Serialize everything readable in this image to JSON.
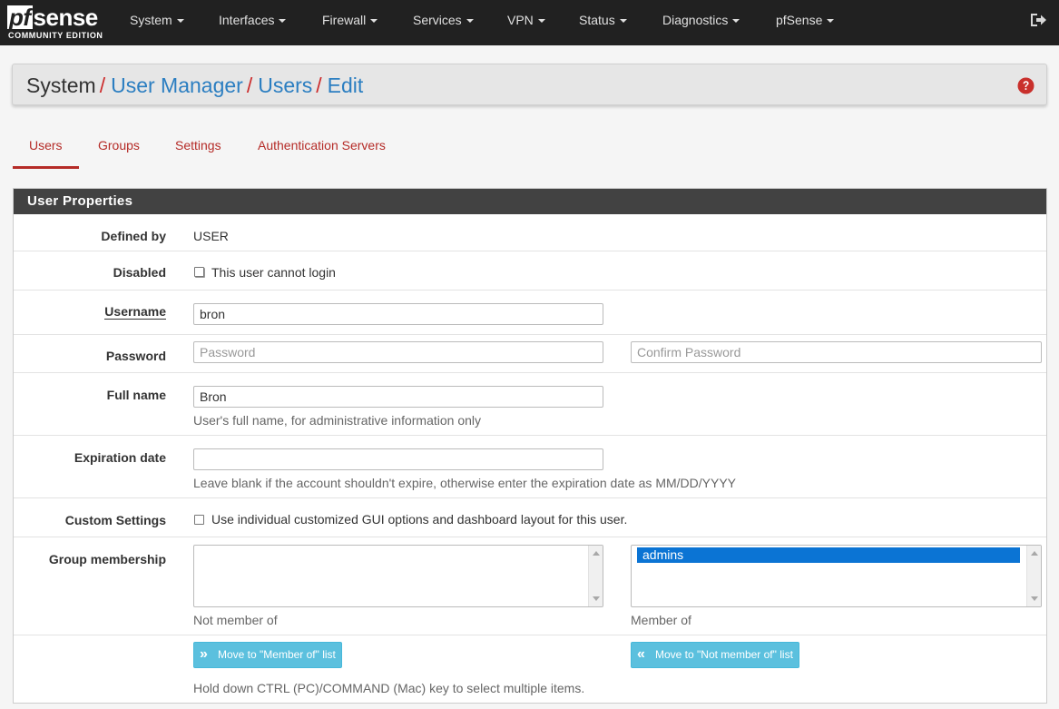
{
  "navbar": {
    "logo_main": "sense",
    "logo_pf": "pf",
    "logo_sub": "COMMUNITY EDITION",
    "items": [
      {
        "label": "System"
      },
      {
        "label": "Interfaces"
      },
      {
        "label": "Firewall"
      },
      {
        "label": "Services"
      },
      {
        "label": "VPN"
      },
      {
        "label": "Status"
      },
      {
        "label": "Diagnostics"
      },
      {
        "label": "pfSense"
      }
    ],
    "logout_icon": "sign-out-icon"
  },
  "breadcrumb": {
    "root": "System",
    "items": [
      "User Manager",
      "Users",
      "Edit"
    ],
    "separator": "/",
    "help_icon": "question-circle-icon"
  },
  "tabs": [
    {
      "label": "Users",
      "active": true
    },
    {
      "label": "Groups",
      "active": false
    },
    {
      "label": "Settings",
      "active": false
    },
    {
      "label": "Authentication Servers",
      "active": false
    }
  ],
  "panel": {
    "title": "User Properties",
    "defined_by": {
      "label": "Defined by",
      "value": "USER"
    },
    "disabled": {
      "label": "Disabled",
      "checkbox_label": "This user cannot login",
      "checked": false
    },
    "username": {
      "label": "Username",
      "value": "bron"
    },
    "password": {
      "label": "Password",
      "placeholder": "Password",
      "confirm_placeholder": "Confirm Password"
    },
    "full_name": {
      "label": "Full name",
      "value": "Bron",
      "help": "User's full name, for administrative information only"
    },
    "expiration": {
      "label": "Expiration date",
      "value": "",
      "help": "Leave blank if the account shouldn't expire, otherwise enter the expiration date as MM/DD/YYYY"
    },
    "custom_settings": {
      "label": "Custom Settings",
      "checkbox_label": "Use individual customized GUI options and dashboard layout for this user.",
      "checked": false
    },
    "group_membership": {
      "label": "Group membership",
      "not_member_label": "Not member of",
      "member_label": "Member of",
      "not_member_options": [],
      "member_options": [
        "admins"
      ],
      "move_to_member_button": "Move to \"Member of\" list",
      "move_to_not_member_button": "Move to \"Not member of\" list",
      "help": "Hold down CTRL (PC)/COMMAND (Mac) key to select multiple items."
    }
  },
  "colors": {
    "navbar": "#212121",
    "link": "#2b7ec1",
    "tab": "#b52b27",
    "panel_heading": "#424242",
    "info_button": "#5bc0de",
    "selected_option": "#0b74d4"
  }
}
